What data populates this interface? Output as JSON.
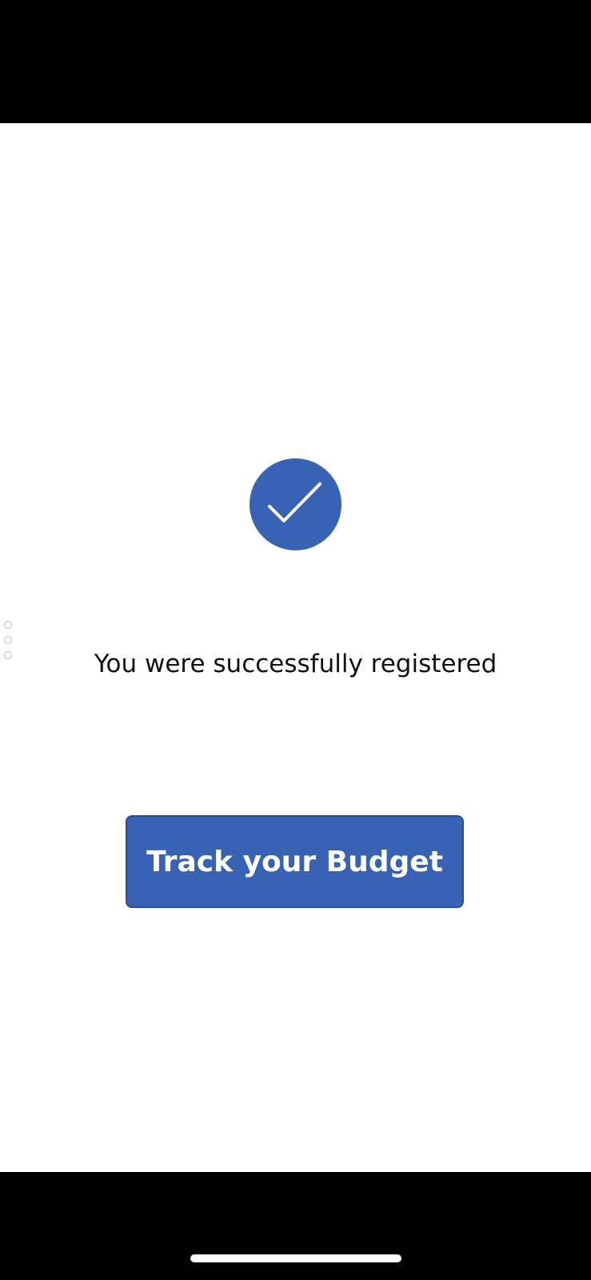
{
  "app": {
    "background": "#ffffff",
    "accent_color": "#3862b4"
  },
  "success_icon": {
    "name": "checkmark-icon",
    "color": "#3862b4"
  },
  "message": {
    "text": "You were successfully registered"
  },
  "primary_action": {
    "label": "Track your Budget"
  },
  "system": {
    "home_indicator": "home-indicator"
  }
}
